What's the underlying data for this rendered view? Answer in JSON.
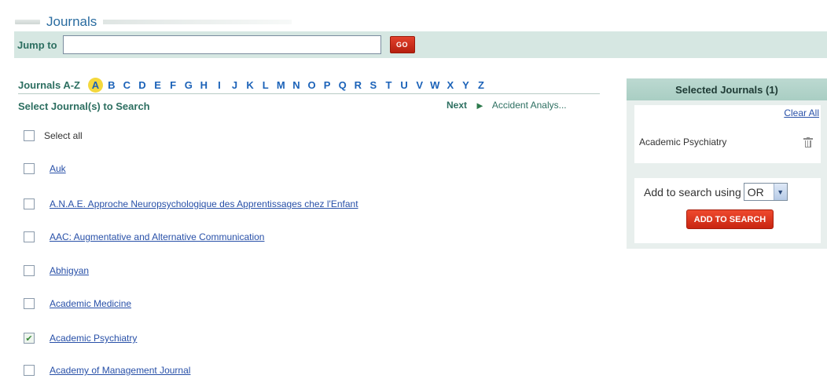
{
  "header": {
    "title": "Journals"
  },
  "jump": {
    "label": "Jump to",
    "value": "",
    "go_label": "GO"
  },
  "az": {
    "label": "Journals A-Z",
    "letters": [
      "A",
      "B",
      "C",
      "D",
      "E",
      "F",
      "G",
      "H",
      "I",
      "J",
      "K",
      "L",
      "M",
      "N",
      "O",
      "P",
      "Q",
      "R",
      "S",
      "T",
      "U",
      "V",
      "W",
      "X",
      "Y",
      "Z"
    ],
    "active": "A"
  },
  "select_heading": "Select Journal(s) to Search",
  "next": {
    "label": "Next",
    "journal": "Accident Analys..."
  },
  "select_all": {
    "label": "Select all",
    "checked": false
  },
  "journals": [
    {
      "name": "Auk",
      "checked": false
    },
    {
      "name": "A.N.A.E. Approche Neuropsychologique des Apprentissages chez l'Enfant",
      "checked": false
    },
    {
      "name": "AAC: Augmentative and Alternative Communication",
      "checked": false
    },
    {
      "name": "Abhigyan",
      "checked": false
    },
    {
      "name": "Academic Medicine",
      "checked": false
    },
    {
      "name": "Academic Psychiatry",
      "checked": true
    },
    {
      "name": "Academy of Management Journal",
      "checked": false
    }
  ],
  "panel": {
    "title": "Selected Journals (1)",
    "clear_all": "Clear All",
    "selected": [
      "Academic Psychiatry"
    ],
    "search_label": "Add to search using",
    "operator": "OR",
    "add_button": "ADD TO SEARCH"
  },
  "colors": {
    "accent_green": "#2d6f61",
    "link_blue": "#2850a8",
    "letter_blue": "#1b62b8",
    "active_letter_bg": "#f4d83d",
    "button_red": "#d32f18",
    "band_bg": "#d6e7e2"
  }
}
